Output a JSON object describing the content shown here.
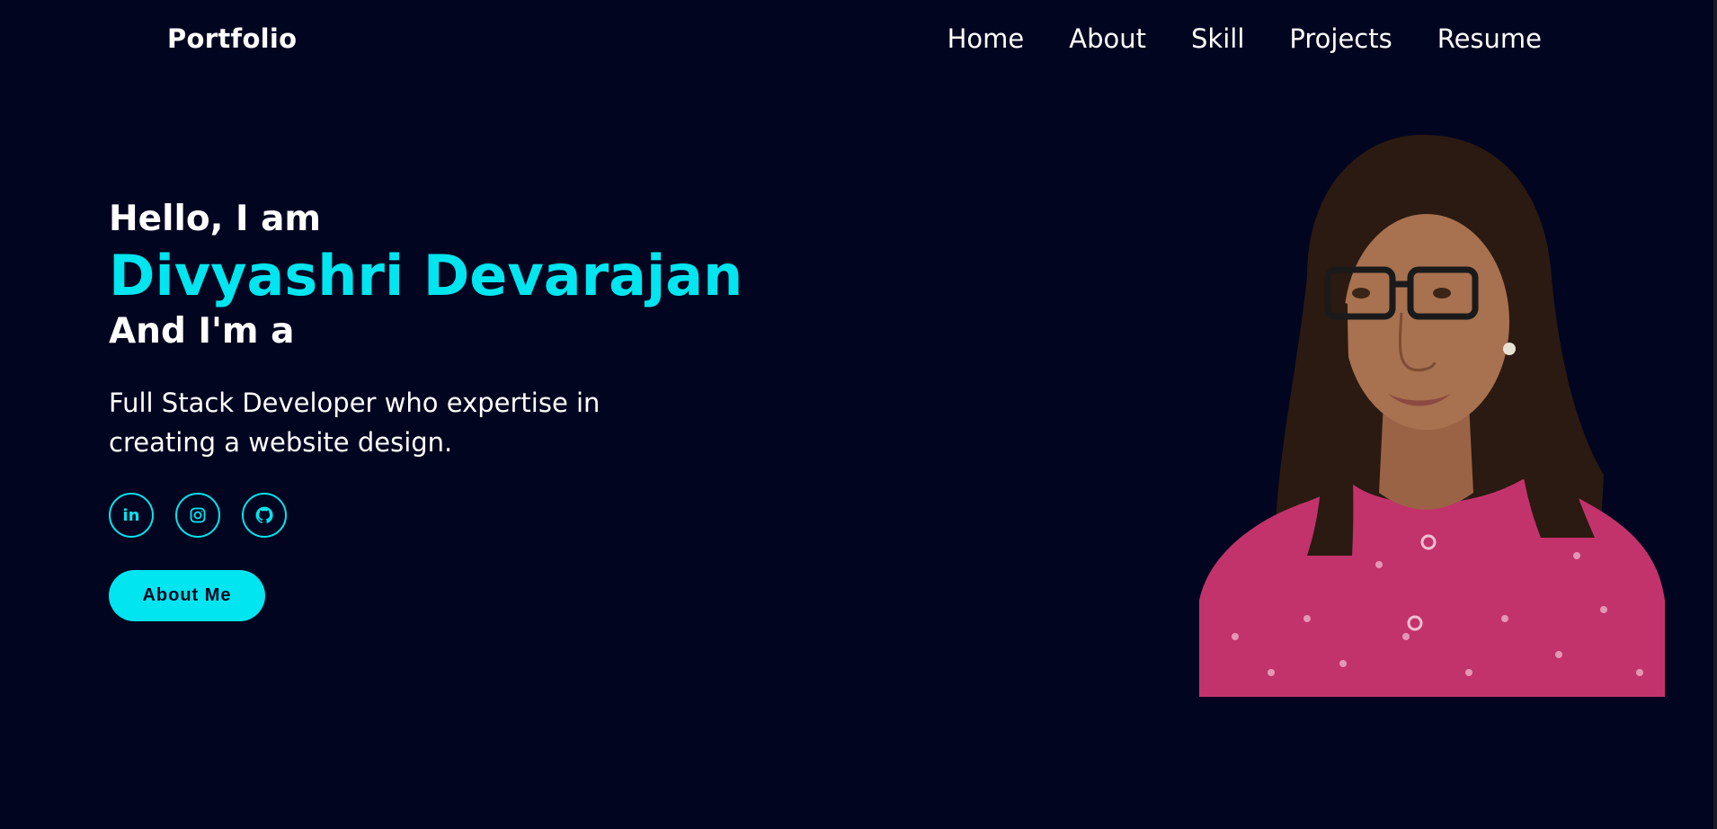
{
  "header": {
    "brand": "Portfolio",
    "nav": [
      "Home",
      "About",
      "Skill",
      "Projects",
      "Resume"
    ]
  },
  "hero": {
    "greeting": "Hello, I am",
    "name": "Divyashri Devarajan",
    "role_prefix": "And I'm a",
    "description": "Full Stack Developer who expertise in creating a website design.",
    "socials": [
      {
        "icon": "linkedin-icon",
        "glyph": "in"
      },
      {
        "icon": "instagram-icon"
      },
      {
        "icon": "github-icon"
      }
    ],
    "cta_label": "About Me"
  },
  "colors": {
    "background": "#020520",
    "accent": "#00e5ef",
    "text": "#ffffff",
    "shirt": "#c2336b",
    "hair": "#2a1a12",
    "skin": "#a8714f"
  }
}
